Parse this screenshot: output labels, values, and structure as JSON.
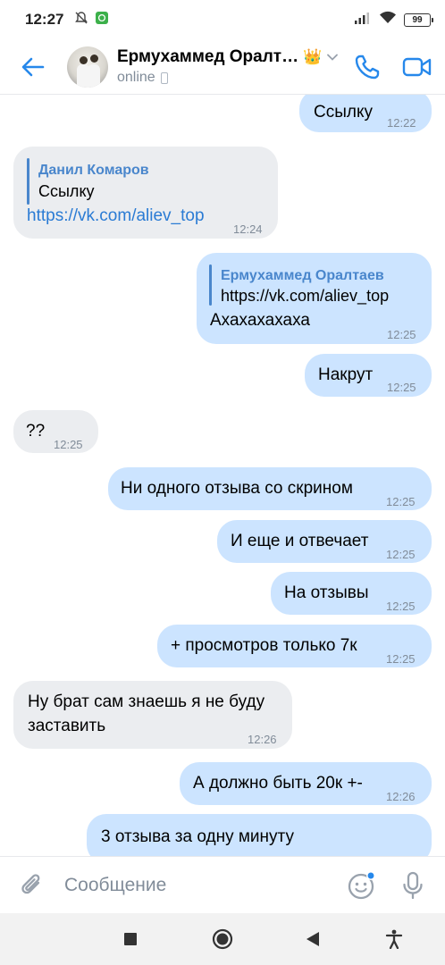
{
  "status_bar": {
    "time": "12:27",
    "battery": "99"
  },
  "header": {
    "title": "Ермухаммед Оралт…",
    "crown_emoji": "👑",
    "status": "online"
  },
  "messages": [
    {
      "dir": "out",
      "text": "Ссылку",
      "time": "12:22"
    },
    {
      "dir": "in",
      "quote_author": "Данил Комаров",
      "quote_text": "Ссылку",
      "text": "https://vk.com/aliev_top",
      "time": "12:24"
    },
    {
      "dir": "out",
      "quote_author": "Ермухаммед Оралтаев",
      "quote_text": "https://vk.com/aliev_top",
      "text": "Ахахахахаха",
      "time": "12:25"
    },
    {
      "dir": "out",
      "text": "Накрут",
      "time": "12:25"
    },
    {
      "dir": "in",
      "text": "??",
      "time": "12:25"
    },
    {
      "dir": "out",
      "text": "Ни одного отзыва со скрином",
      "time": "12:25"
    },
    {
      "dir": "out",
      "text": "И еще и отвечает",
      "time": "12:25"
    },
    {
      "dir": "out",
      "text": "На отзывы",
      "time": "12:25"
    },
    {
      "dir": "out",
      "text": "+ просмотров только 7к",
      "time": "12:25"
    },
    {
      "dir": "in",
      "text_line1": "Ну брат сам знаешь я не буду",
      "text_line2": "заставить",
      "time": "12:26"
    },
    {
      "dir": "out",
      "text": "А должно быть 20к +-",
      "time": "12:26"
    },
    {
      "dir": "out",
      "text": "3 отзыва за одну минуту",
      "time": ""
    }
  ],
  "composer": {
    "placeholder": "Сообщение"
  },
  "icons": {
    "back": "back-arrow-icon",
    "phone": "phone-icon",
    "video": "video-icon",
    "attach": "paperclip-icon",
    "sticker": "smile-icon",
    "mic": "microphone-icon"
  },
  "colors": {
    "accent": "#2688eb",
    "outgoing": "#cce4ff",
    "incoming": "#ebedf0",
    "link": "#2a7bd4"
  }
}
